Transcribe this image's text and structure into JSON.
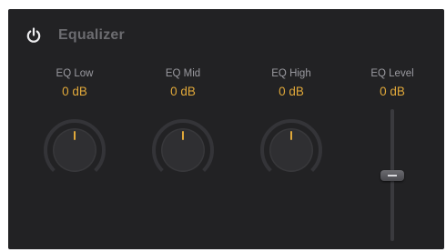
{
  "plugin": {
    "title": "Equalizer",
    "power_on": true
  },
  "controls": [
    {
      "label": "EQ Low",
      "value": "0 dB",
      "type": "knob"
    },
    {
      "label": "EQ Mid",
      "value": "0 dB",
      "type": "knob"
    },
    {
      "label": "EQ High",
      "value": "0 dB",
      "type": "knob"
    },
    {
      "label": "EQ Level",
      "value": "0 dB",
      "type": "fader",
      "level_fraction": 0.5
    }
  ],
  "colors": {
    "value_accent": "#e0a83a",
    "label_gray": "#9a9aa0",
    "panel_bg": "#222224"
  }
}
